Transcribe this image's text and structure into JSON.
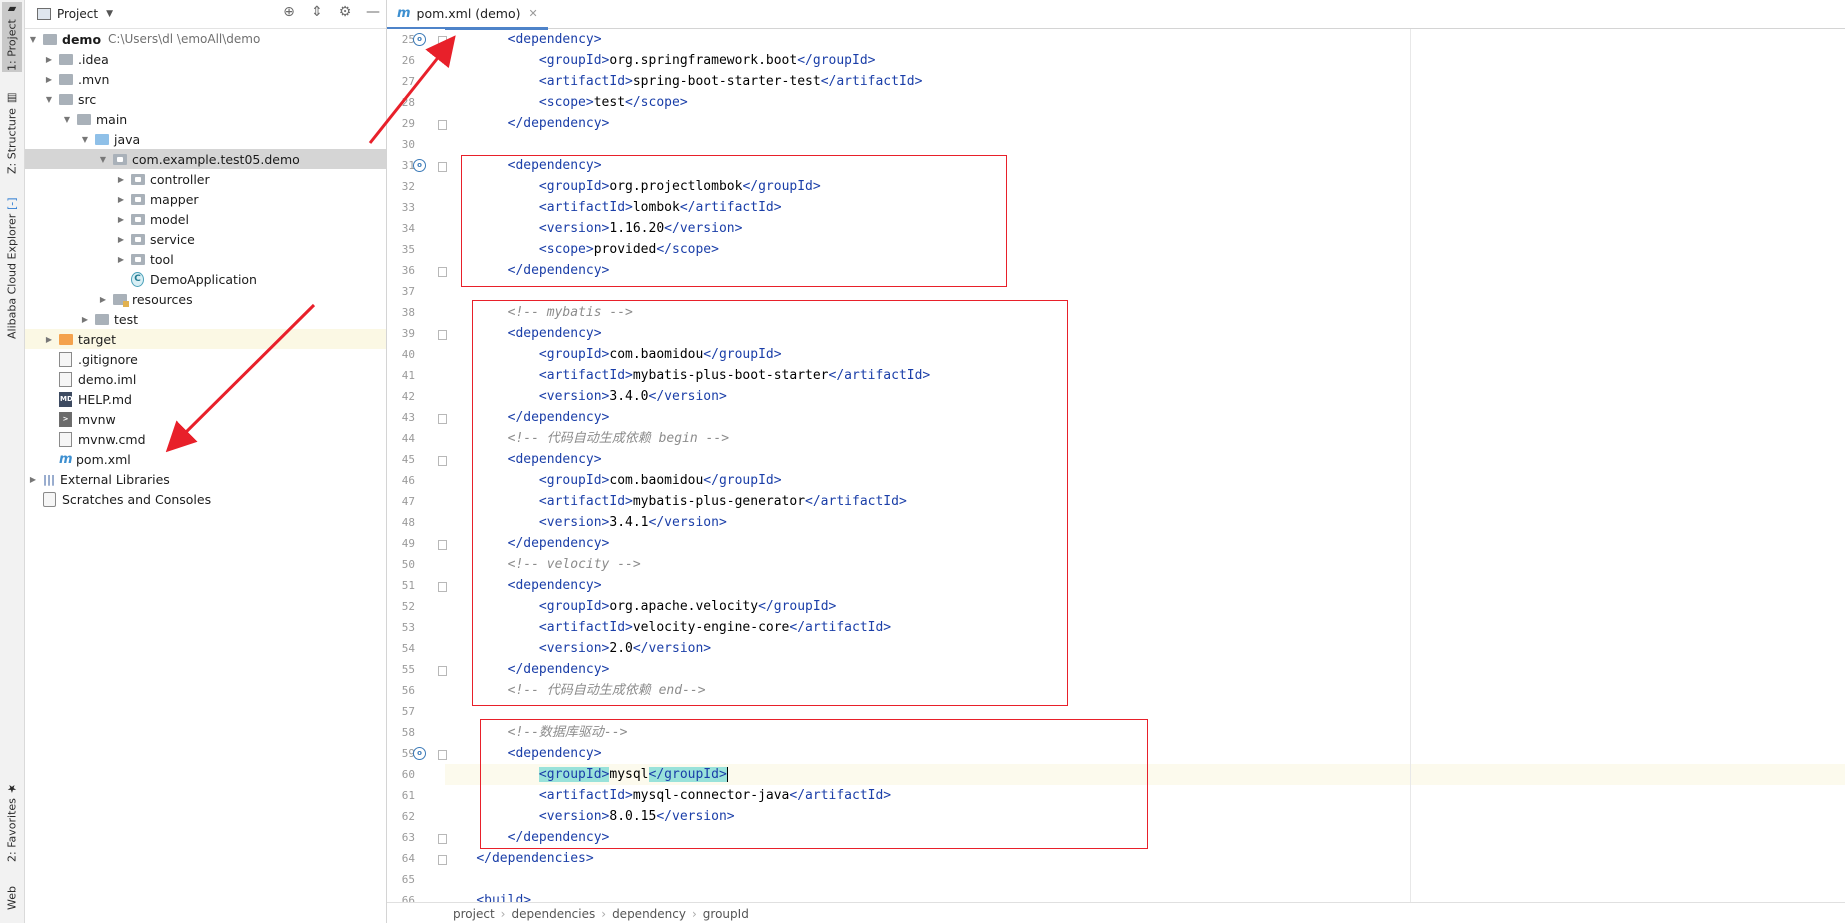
{
  "tool_windows": {
    "left": [
      {
        "label": "1: Project",
        "icon": "folder-icon",
        "active": true
      },
      {
        "label": "Z: Structure",
        "icon": "structure-icon",
        "active": false
      },
      {
        "label": "Alibaba Cloud Explorer",
        "icon": "cloud-icon",
        "active": false
      },
      {
        "label": "2: Favorites",
        "icon": "star-icon",
        "active": false
      },
      {
        "label": "Web",
        "icon": "web-icon",
        "active": false
      }
    ]
  },
  "project_panel": {
    "title": "Project",
    "tree": [
      {
        "label": "demo",
        "path": "C:\\Users\\dl                \\emoAll\\demo",
        "bold": true
      },
      {
        "label": ".idea"
      },
      {
        "label": ".mvn"
      },
      {
        "label": "src"
      },
      {
        "label": "main"
      },
      {
        "label": "java"
      },
      {
        "label": "com.example.test05.demo"
      },
      {
        "label": "controller"
      },
      {
        "label": "mapper"
      },
      {
        "label": "model"
      },
      {
        "label": "service"
      },
      {
        "label": "tool"
      },
      {
        "label": "DemoApplication"
      },
      {
        "label": "resources"
      },
      {
        "label": "test"
      },
      {
        "label": "target"
      },
      {
        "label": ".gitignore"
      },
      {
        "label": "demo.iml"
      },
      {
        "label": "HELP.md"
      },
      {
        "label": "mvnw"
      },
      {
        "label": "mvnw.cmd"
      },
      {
        "label": "pom.xml"
      },
      {
        "label": "External Libraries"
      },
      {
        "label": "Scratches and Consoles"
      }
    ]
  },
  "editor": {
    "tab": {
      "label": "pom.xml (demo)"
    },
    "lines": [
      {
        "n": "25",
        "text": "        <dependency>"
      },
      {
        "n": "26",
        "text": "            <groupId>org.springframework.boot</groupId>"
      },
      {
        "n": "27",
        "text": "            <artifactId>spring-boot-starter-test</artifactId>"
      },
      {
        "n": "28",
        "text": "            <scope>test</scope>"
      },
      {
        "n": "29",
        "text": "        </dependency>"
      },
      {
        "n": "30",
        "text": ""
      },
      {
        "n": "31",
        "text": "        <dependency>"
      },
      {
        "n": "32",
        "text": "            <groupId>org.projectlombok</groupId>"
      },
      {
        "n": "33",
        "text": "            <artifactId>lombok</artifactId>"
      },
      {
        "n": "34",
        "text": "            <version>1.16.20</version>"
      },
      {
        "n": "35",
        "text": "            <scope>provided</scope>"
      },
      {
        "n": "36",
        "text": "        </dependency>"
      },
      {
        "n": "37",
        "text": ""
      },
      {
        "n": "38",
        "text": "        <!-- mybatis -->"
      },
      {
        "n": "39",
        "text": "        <dependency>"
      },
      {
        "n": "40",
        "text": "            <groupId>com.baomidou</groupId>"
      },
      {
        "n": "41",
        "text": "            <artifactId>mybatis-plus-boot-starter</artifactId>"
      },
      {
        "n": "42",
        "text": "            <version>3.4.0</version>"
      },
      {
        "n": "43",
        "text": "        </dependency>"
      },
      {
        "n": "44",
        "text": "        <!-- 代码自动生成依赖 begin -->"
      },
      {
        "n": "45",
        "text": "        <dependency>"
      },
      {
        "n": "46",
        "text": "            <groupId>com.baomidou</groupId>"
      },
      {
        "n": "47",
        "text": "            <artifactId>mybatis-plus-generator</artifactId>"
      },
      {
        "n": "48",
        "text": "            <version>3.4.1</version>"
      },
      {
        "n": "49",
        "text": "        </dependency>"
      },
      {
        "n": "50",
        "text": "        <!-- velocity -->"
      },
      {
        "n": "51",
        "text": "        <dependency>"
      },
      {
        "n": "52",
        "text": "            <groupId>org.apache.velocity</groupId>"
      },
      {
        "n": "53",
        "text": "            <artifactId>velocity-engine-core</artifactId>"
      },
      {
        "n": "54",
        "text": "            <version>2.0</version>"
      },
      {
        "n": "55",
        "text": "        </dependency>"
      },
      {
        "n": "56",
        "text": "        <!-- 代码自动生成依赖 end-->"
      },
      {
        "n": "57",
        "text": ""
      },
      {
        "n": "58",
        "text": "        <!--数据库驱动-->"
      },
      {
        "n": "59",
        "text": "        <dependency>"
      },
      {
        "n": "60",
        "text": "            <groupId>mysql</groupId>"
      },
      {
        "n": "61",
        "text": "            <artifactId>mysql-connector-java</artifactId>"
      },
      {
        "n": "62",
        "text": "            <version>8.0.15</version>"
      },
      {
        "n": "63",
        "text": "        </dependency>"
      },
      {
        "n": "64",
        "text": "    </dependencies>"
      },
      {
        "n": "65",
        "text": ""
      },
      {
        "n": "66",
        "text": "    <build>"
      }
    ],
    "current_line": "60"
  },
  "breadcrumbs": [
    "project",
    "dependencies",
    "dependency",
    "groupId"
  ],
  "colors": {
    "tag": "#1a3ea8",
    "comment": "#8c8c8c",
    "annotation_red": "#e8202a",
    "selection": "#d5d5d5"
  }
}
